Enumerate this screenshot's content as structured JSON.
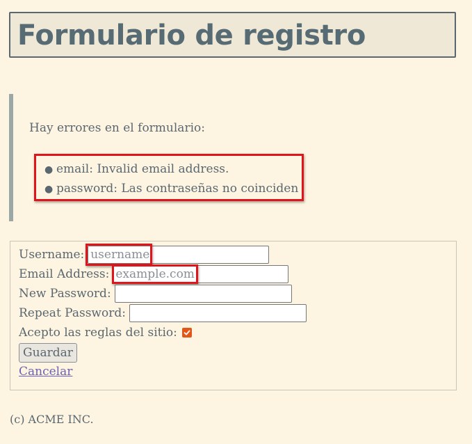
{
  "page": {
    "title": "Formulario de registro",
    "footer": "(c) ACME INC."
  },
  "errors": {
    "intro": "Hay errores en el formulario:",
    "items": [
      "email: Invalid email address.",
      "password: Las contraseñas no coinciden"
    ]
  },
  "form": {
    "username": {
      "label": "Username:",
      "value": "username"
    },
    "email": {
      "label": "Email Address:",
      "value": "example.com"
    },
    "new_password": {
      "label": "New Password:",
      "value": ""
    },
    "repeat_password": {
      "label": "Repeat Password:",
      "value": ""
    },
    "accept": {
      "label": "Acepto las reglas del sitio:",
      "checked": true
    },
    "save_label": "Guardar",
    "cancel_label": "Cancelar"
  },
  "colors": {
    "highlight": "#e0151b",
    "checkbox": "#e3561a",
    "link": "#6b62b3",
    "background": "#fdf5e1"
  }
}
